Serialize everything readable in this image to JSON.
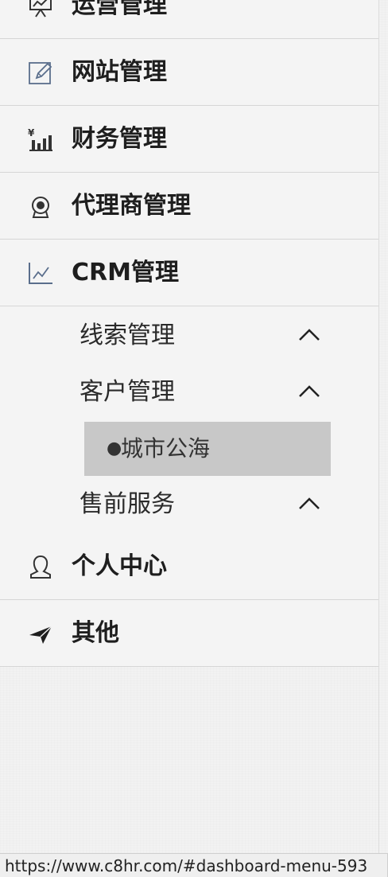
{
  "menu": {
    "items": [
      {
        "label": "运营管理",
        "icon": "presentation-board-icon"
      },
      {
        "label": "网站管理",
        "icon": "edit-pencil-icon"
      },
      {
        "label": "财务管理",
        "icon": "yuan-bar-chart-icon"
      },
      {
        "label": "代理商管理",
        "icon": "agent-badge-icon"
      },
      {
        "label": "CRM管理",
        "icon": "line-chart-icon"
      },
      {
        "label": "个人中心",
        "icon": "user-icon"
      },
      {
        "label": "其他",
        "icon": "paper-plane-icon"
      }
    ]
  },
  "crm_submenu": {
    "items": [
      {
        "label": "线索管理",
        "expanded": true
      },
      {
        "label": "客户管理",
        "expanded": true
      },
      {
        "label": "售前服务",
        "expanded": true
      }
    ],
    "active_leaf": {
      "bullet": "●",
      "label": "城市公海"
    }
  },
  "status_bar": {
    "url": "https://www.c8hr.com/#dashboard-menu-593"
  },
  "colors": {
    "background": "#f4f4f4",
    "active_highlight": "#c8c8c8",
    "icon_blue": "#5a6e8c",
    "text": "#1e1e1e",
    "divider": "#d6d6d6"
  }
}
